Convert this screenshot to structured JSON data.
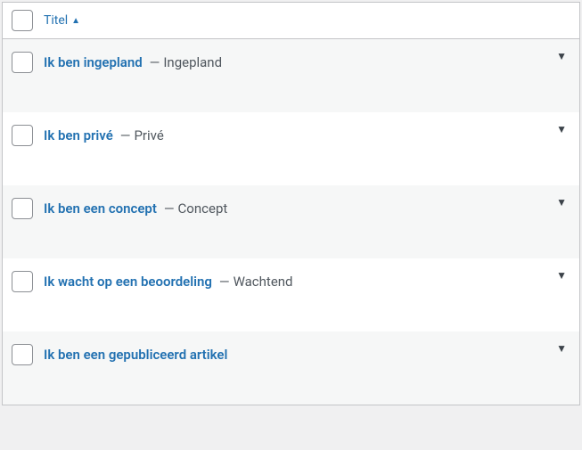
{
  "header": {
    "column_label": "Titel"
  },
  "rows": [
    {
      "title": "Ik ben ingepland",
      "status": "Ingepland"
    },
    {
      "title": "Ik ben privé",
      "status": "Privé"
    },
    {
      "title": "Ik ben een concept",
      "status": "Concept"
    },
    {
      "title": "Ik wacht op een beoordeling",
      "status": "Wachtend"
    },
    {
      "title": "Ik ben een gepubliceerd artikel",
      "status": ""
    }
  ]
}
